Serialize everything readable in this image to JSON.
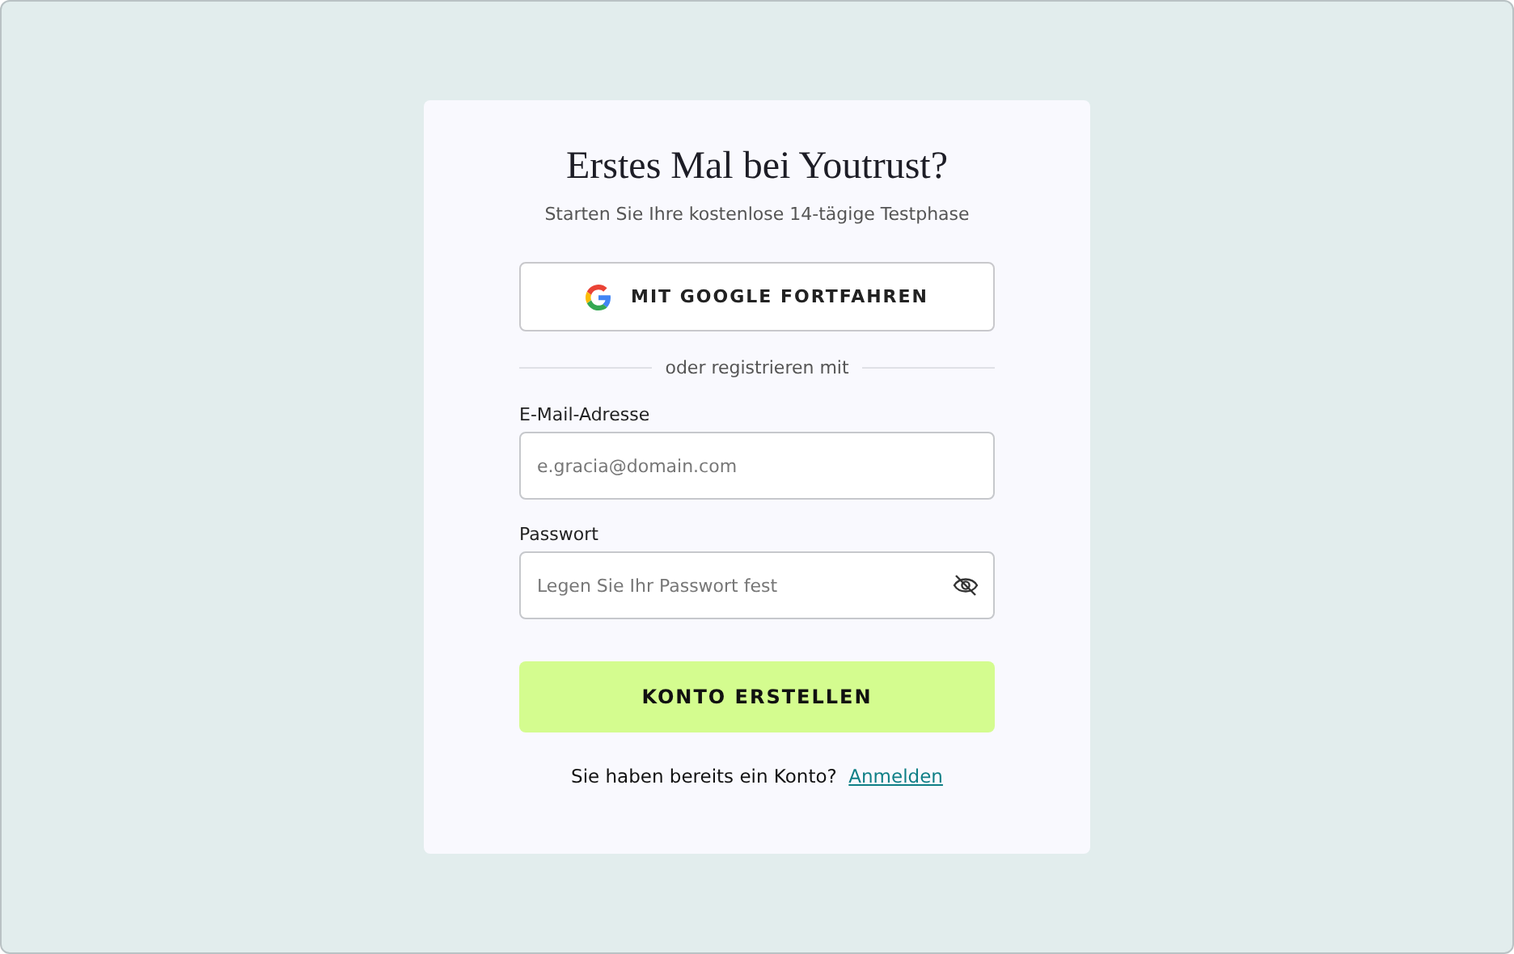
{
  "title": "Erstes Mal bei Youtrust?",
  "subtitle": "Starten Sie Ihre kostenlose 14-tägige Testphase",
  "google_button": "MIT GOOGLE FORTFAHREN",
  "divider": "oder registrieren mit",
  "fields": [
    {
      "label": "E-Mail-Adresse",
      "placeholder": "e.gracia@domain.com",
      "kind": "email"
    },
    {
      "label": "Passwort",
      "placeholder": "Legen Sie Ihr Passwort fest",
      "kind": "password"
    }
  ],
  "submit": "KONTO ERSTELLEN",
  "footer": {
    "text": "Sie haben bereits ein Konto?",
    "link": "Anmelden"
  }
}
